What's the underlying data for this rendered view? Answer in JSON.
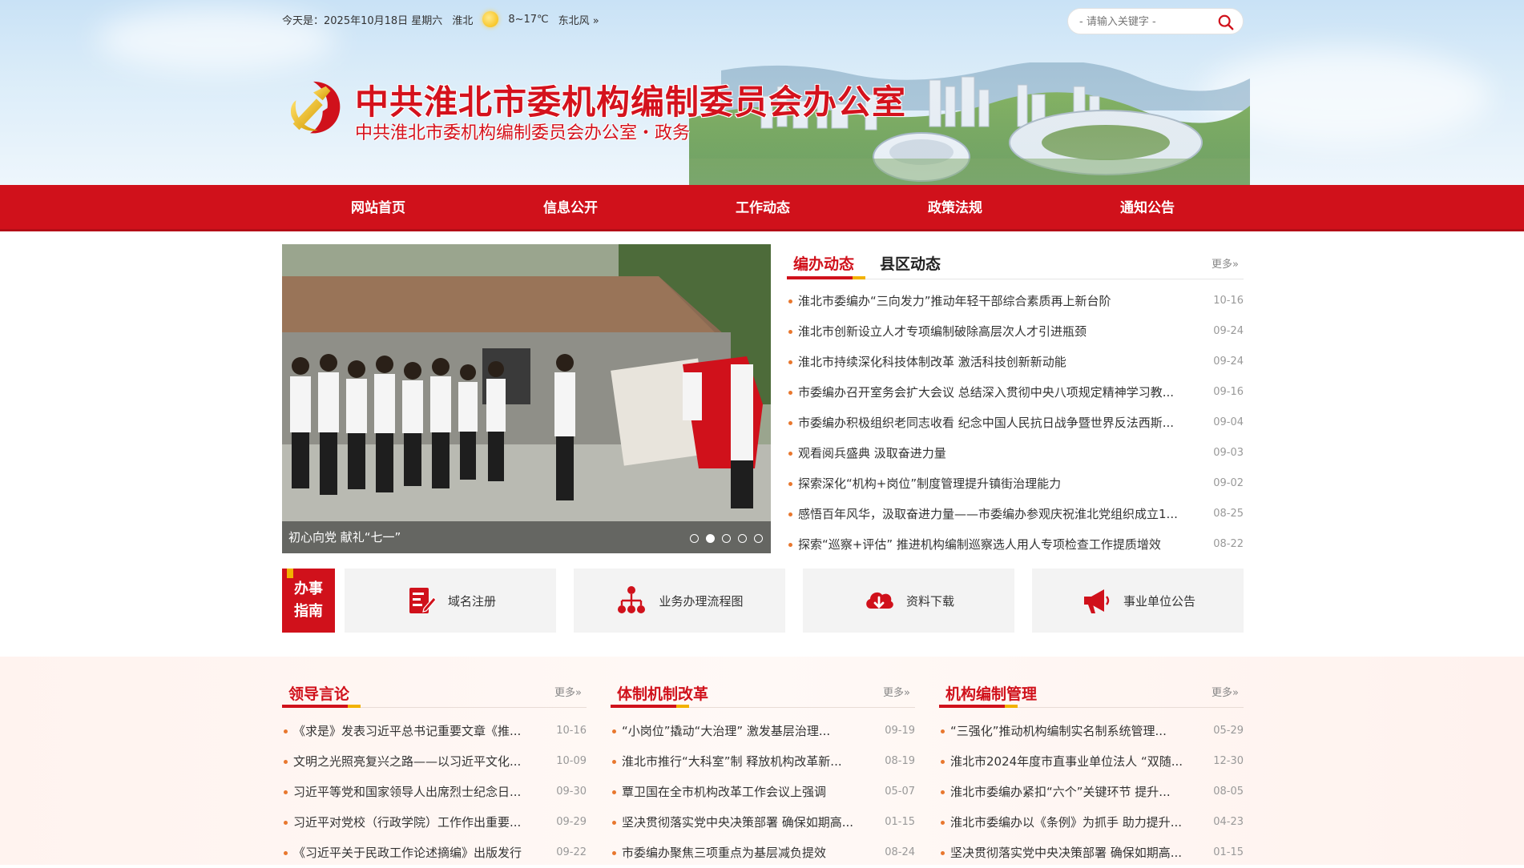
{
  "topbar": {
    "date": "今天是：2025年10月18日 星期六",
    "city": "淮北",
    "temperature": "8~17℃",
    "wind": "东北风 »",
    "weather_icon": "sun-icon"
  },
  "search": {
    "placeholder": "- 请输入关键字 -"
  },
  "header": {
    "title": "中共淮北市委机构编制委员会办公室",
    "subtitle": "中共淮北市委机构编制委员会办公室・政务"
  },
  "nav": [
    "网站首页",
    "信息公开",
    "工作动态",
    "政策法规",
    "通知公告"
  ],
  "slider": {
    "caption": "初心向党 献礼“七一”",
    "slide_count": 5,
    "active_index": 1
  },
  "news": {
    "tabs": [
      "编办动态",
      "县区动态"
    ],
    "more": "更多»",
    "items": [
      {
        "title": "淮北市委编办“三向发力”推动年轻干部综合素质再上新台阶",
        "date": "10-16"
      },
      {
        "title": "淮北市创新设立人才专项编制破除高层次人才引进瓶颈",
        "date": "09-24"
      },
      {
        "title": "淮北市持续深化科技体制改革 激活科技创新新动能",
        "date": "09-24"
      },
      {
        "title": "市委编办召开室务会扩大会议 总结深入贯彻中央八项规定精神学习教...",
        "date": "09-16"
      },
      {
        "title": "市委编办积极组织老同志收看 纪念中国人民抗日战争暨世界反法西斯...",
        "date": "09-04"
      },
      {
        "title": "观看阅兵盛典 汲取奋进力量",
        "date": "09-03"
      },
      {
        "title": "探索深化“机构+岗位”制度管理提升镇街治理能力",
        "date": "09-02"
      },
      {
        "title": "感悟百年风华，汲取奋进力量——市委编办参观庆祝淮北党组织成立1...",
        "date": "08-25"
      },
      {
        "title": "探索“巡察+评估” 推进机构编制巡察选人用人专项检查工作提质增效",
        "date": "08-22"
      }
    ]
  },
  "guide": {
    "label_line1": "办事",
    "label_line2": "指南",
    "items": [
      {
        "label": "域名注册",
        "icon": "document-edit-icon"
      },
      {
        "label": "业务办理流程图",
        "icon": "org-chart-icon"
      },
      {
        "label": "资料下载",
        "icon": "cloud-download-icon"
      },
      {
        "label": "事业单位公告",
        "icon": "megaphone-icon"
      }
    ]
  },
  "columns": [
    {
      "title": "领导言论",
      "more": "更多»",
      "items": [
        {
          "title": "《求是》发表习近平总书记重要文章《推...",
          "date": "10-16"
        },
        {
          "title": "文明之光照亮复兴之路——以习近平文化...",
          "date": "10-09"
        },
        {
          "title": "习近平等党和国家领导人出席烈士纪念日...",
          "date": "09-30"
        },
        {
          "title": "习近平对党校（行政学院）工作作出重要...",
          "date": "09-29"
        },
        {
          "title": "《习近平关于民政工作论述摘编》出版发行",
          "date": "09-22"
        }
      ]
    },
    {
      "title": "体制机制改革",
      "more": "更多»",
      "items": [
        {
          "title": "“小岗位”撬动“大治理” 激发基层治理...",
          "date": "09-19"
        },
        {
          "title": "淮北市推行“大科室”制 释放机构改革新...",
          "date": "08-19"
        },
        {
          "title": "覃卫国在全市机构改革工作会议上强调",
          "date": "05-07"
        },
        {
          "title": "坚决贯彻落实党中央决策部署 确保如期高...",
          "date": "01-15"
        },
        {
          "title": "市委编办聚焦三项重点为基层减负提效",
          "date": "08-24"
        }
      ]
    },
    {
      "title": "机构编制管理",
      "more": "更多»",
      "items": [
        {
          "title": "“三强化”推动机构编制实名制系统管理...",
          "date": "05-29"
        },
        {
          "title": "淮北市2024年度市直事业单位法人 “双随...",
          "date": "12-30"
        },
        {
          "title": "淮北市委编办紧扣“六个”关键环节 提升...",
          "date": "08-05"
        },
        {
          "title": "淮北市委编办以《条例》为抓手 助力提升...",
          "date": "04-23"
        },
        {
          "title": "坚决贯彻落实党中央决策部署 确保如期高...",
          "date": "01-15"
        }
      ]
    }
  ],
  "colors": {
    "primary_red": "#d0111b",
    "accent_gold": "#f2b200",
    "bullet_orange": "#e8772e"
  }
}
